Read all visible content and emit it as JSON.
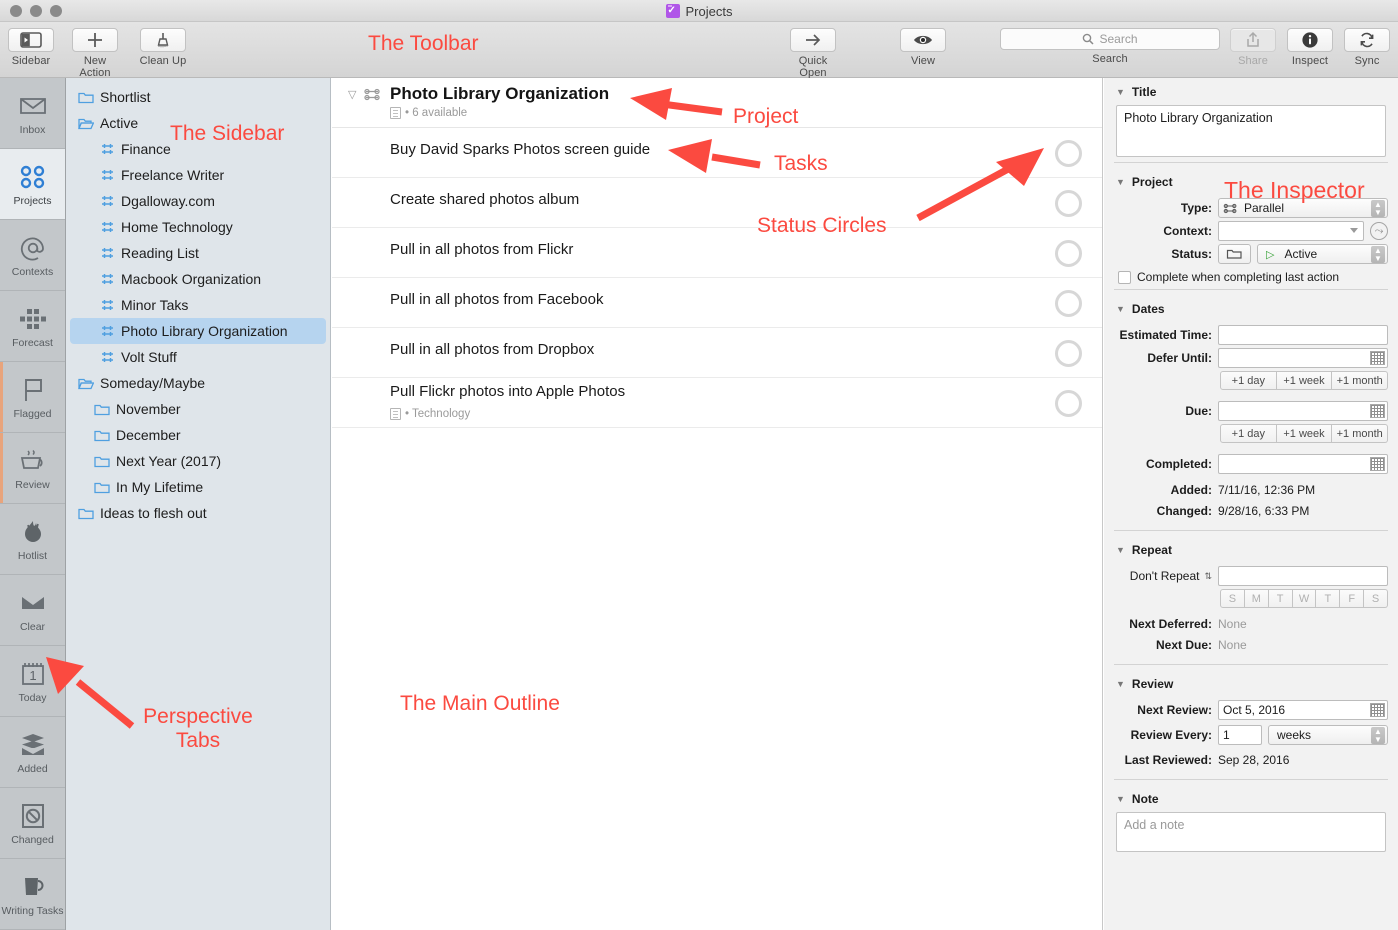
{
  "window": {
    "title": "Projects"
  },
  "toolbar": {
    "items": [
      {
        "label": "Sidebar",
        "icon": "sidebar-icon"
      },
      {
        "label": "New Action",
        "icon": "plus-icon"
      },
      {
        "label": "Clean Up",
        "icon": "broom-icon"
      },
      {
        "label": "Quick Open",
        "icon": "arrow-right-icon"
      },
      {
        "label": "View",
        "icon": "eye-icon"
      }
    ],
    "search": {
      "label": "Search",
      "placeholder": "Search",
      "icon": "search-icon"
    },
    "share": {
      "label": "Share",
      "icon": "share-icon",
      "disabled": true
    },
    "inspect": {
      "label": "Inspect",
      "icon": "info-icon"
    },
    "sync": {
      "label": "Sync",
      "icon": "sync-icon"
    }
  },
  "perspectives": [
    {
      "label": "Inbox",
      "icon": "inbox-icon",
      "selected": false,
      "accent": false
    },
    {
      "label": "Projects",
      "icon": "projects-icon",
      "selected": true,
      "accent": false
    },
    {
      "label": "Contexts",
      "icon": "at-icon",
      "selected": false,
      "accent": false
    },
    {
      "label": "Forecast",
      "icon": "forecast-grid-icon",
      "selected": false,
      "accent": false
    },
    {
      "label": "Flagged",
      "icon": "flag-icon",
      "selected": false,
      "accent": true
    },
    {
      "label": "Review",
      "icon": "coffee-cup-icon",
      "selected": false,
      "accent": true
    },
    {
      "label": "Hotlist",
      "icon": "flame-icon",
      "selected": false,
      "accent": false
    },
    {
      "label": "Clear",
      "icon": "tray-icon",
      "selected": false,
      "accent": false
    },
    {
      "label": "Today",
      "icon": "calendar-icon",
      "selected": false,
      "accent": false,
      "badge": "1"
    },
    {
      "label": "Added",
      "icon": "stack-tray-icon",
      "selected": false,
      "accent": false
    },
    {
      "label": "Changed",
      "icon": "no-entry-icon",
      "selected": false,
      "accent": false
    },
    {
      "label": "Writing Tasks",
      "icon": "mug-icon",
      "selected": false,
      "accent": false
    }
  ],
  "sidebar": {
    "items": [
      {
        "label": "Shortlist",
        "icon": "folder-icon",
        "indent": 0,
        "selected": false
      },
      {
        "label": "Active",
        "icon": "folder-open-icon",
        "indent": 0,
        "selected": false
      },
      {
        "label": "Finance",
        "icon": "parallel-icon",
        "indent": 1,
        "selected": false
      },
      {
        "label": "Freelance Writer",
        "icon": "parallel-icon",
        "indent": 1,
        "selected": false
      },
      {
        "label": "Dgalloway.com",
        "icon": "parallel-icon",
        "indent": 1,
        "selected": false
      },
      {
        "label": "Home Technology",
        "icon": "parallel-icon",
        "indent": 1,
        "selected": false
      },
      {
        "label": "Reading List",
        "icon": "parallel-icon",
        "indent": 1,
        "selected": false
      },
      {
        "label": "Macbook Organization",
        "icon": "parallel-icon",
        "indent": 1,
        "selected": false
      },
      {
        "label": "Minor Taks",
        "icon": "parallel-icon",
        "indent": 1,
        "selected": false
      },
      {
        "label": "Photo Library Organization",
        "icon": "parallel-icon",
        "indent": 1,
        "selected": true
      },
      {
        "label": "Volt Stuff",
        "icon": "parallel-icon",
        "indent": 1,
        "selected": false
      },
      {
        "label": "Someday/Maybe",
        "icon": "folder-open-icon",
        "indent": 0,
        "selected": false
      },
      {
        "label": "November",
        "icon": "folder-icon",
        "indent": 1,
        "selected": false
      },
      {
        "label": "December",
        "icon": "folder-icon",
        "indent": 1,
        "selected": false
      },
      {
        "label": "Next Year (2017)",
        "icon": "folder-icon",
        "indent": 1,
        "selected": false
      },
      {
        "label": "In My Lifetime",
        "icon": "folder-icon",
        "indent": 1,
        "selected": false
      },
      {
        "label": "Ideas to flesh out",
        "icon": "folder-icon",
        "indent": 0,
        "selected": false
      }
    ]
  },
  "outline": {
    "project": {
      "title": "Photo Library Organization",
      "subtitle": "• 6 available"
    },
    "tasks": [
      {
        "name": "Buy David Sparks Photos screen guide",
        "sub": ""
      },
      {
        "name": "Create shared photos album",
        "sub": ""
      },
      {
        "name": "Pull in all photos from Flickr",
        "sub": ""
      },
      {
        "name": "Pull in all photos from Facebook",
        "sub": ""
      },
      {
        "name": "Pull in all photos from Dropbox",
        "sub": ""
      },
      {
        "name": "Pull Flickr photos into Apple Photos",
        "sub": "• Technology"
      }
    ]
  },
  "inspector": {
    "title_section": {
      "header": "Title",
      "value": "Photo Library Organization"
    },
    "project_section": {
      "header": "Project",
      "type_label": "Type:",
      "type_value": "Parallel",
      "context_label": "Context:",
      "context_value": "",
      "status_label": "Status:",
      "status_value": "Active",
      "complete_checkbox": "Complete when completing last action"
    },
    "dates_section": {
      "header": "Dates",
      "estimated_label": "Estimated Time:",
      "estimated_value": "",
      "defer_label": "Defer Until:",
      "defer_value": "",
      "due_label": "Due:",
      "due_value": "",
      "completed_label": "Completed:",
      "completed_value": "",
      "added_label": "Added:",
      "added_value": "7/11/16, 12:36 PM",
      "changed_label": "Changed:",
      "changed_value": "9/28/16, 6:33 PM",
      "quick_buttons": [
        "+1 day",
        "+1 week",
        "+1 month"
      ]
    },
    "repeat_section": {
      "header": "Repeat",
      "mode": "Don't Repeat",
      "value": "",
      "days": [
        "S",
        "M",
        "T",
        "W",
        "T",
        "F",
        "S"
      ],
      "next_deferred_label": "Next Deferred:",
      "next_deferred_value": "None",
      "next_due_label": "Next Due:",
      "next_due_value": "None"
    },
    "review_section": {
      "header": "Review",
      "next_review_label": "Next Review:",
      "next_review_value": "Oct 5, 2016",
      "review_every_label": "Review Every:",
      "review_every_value": "1",
      "review_every_unit": "weeks",
      "last_reviewed_label": "Last Reviewed:",
      "last_reviewed_value": "Sep 28, 2016"
    },
    "note_section": {
      "header": "Note",
      "placeholder": "Add a note"
    }
  },
  "annotations": {
    "toolbar": "The Toolbar",
    "sidebar": "The Sidebar",
    "project": "Project",
    "tasks": "Tasks",
    "status_circles": "Status Circles",
    "inspector": "The Inspector",
    "main_outline": "The Main Outline",
    "perspective_tabs": "Perspective\nTabs"
  },
  "colors": {
    "annotation": "#fb4a40",
    "selection": "#b6d4ef",
    "accent_blue": "#2f7fd4"
  }
}
